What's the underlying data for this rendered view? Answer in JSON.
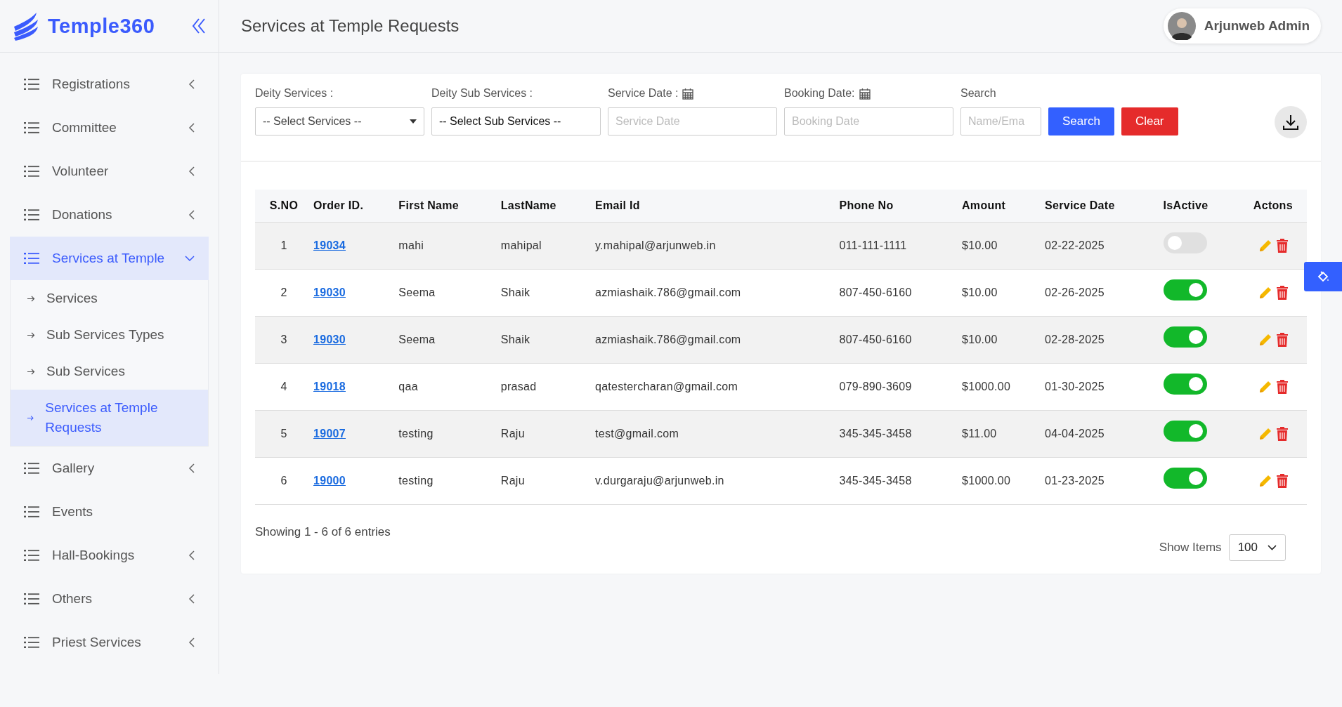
{
  "brand": {
    "name": "Temple360"
  },
  "sidebar": {
    "items": [
      {
        "label": "Registrations",
        "kind": "group",
        "expanded": false,
        "selected": false
      },
      {
        "label": "Committee",
        "kind": "group",
        "expanded": false,
        "selected": false
      },
      {
        "label": "Volunteer",
        "kind": "group",
        "expanded": false,
        "selected": false
      },
      {
        "label": "Donations",
        "kind": "group",
        "expanded": false,
        "selected": false
      },
      {
        "label": "Services at Temple",
        "kind": "group",
        "expanded": true,
        "selected": true,
        "children": [
          {
            "label": "Services",
            "selected": false
          },
          {
            "label": "Sub Services Types",
            "selected": false
          },
          {
            "label": "Sub Services",
            "selected": false
          },
          {
            "label": "Services at Temple Requests",
            "selected": true
          }
        ]
      },
      {
        "label": "Gallery",
        "kind": "group",
        "expanded": false,
        "selected": false
      },
      {
        "label": "Events",
        "kind": "link",
        "selected": false
      },
      {
        "label": "Hall-Bookings",
        "kind": "group",
        "expanded": false,
        "selected": false
      },
      {
        "label": "Others",
        "kind": "group",
        "expanded": false,
        "selected": false
      },
      {
        "label": "Priest Services",
        "kind": "group",
        "expanded": false,
        "selected": false
      }
    ]
  },
  "header": {
    "title": "Services at Temple Requests",
    "user": "Arjunweb Admin"
  },
  "filters": [
    {
      "label": "Deity Services :",
      "kind": "select",
      "value": "-- Select Services --"
    },
    {
      "label": "Deity Sub Services :",
      "kind": "plain_select",
      "value": "-- Select Sub Services --"
    },
    {
      "label": "Service Date :",
      "kind": "date",
      "placeholder": "Service Date"
    },
    {
      "label": "Booking Date:",
      "kind": "date",
      "placeholder": "Booking Date"
    },
    {
      "label": "Search",
      "kind": "text",
      "placeholder": "Name/Ema"
    }
  ],
  "buttons": [
    {
      "label": "Search",
      "kind": "primary"
    },
    {
      "label": "Clear",
      "kind": "danger"
    }
  ],
  "table": {
    "columns": [
      "S.NO",
      "Order ID.",
      "First Name",
      "LastName",
      "Email Id",
      "Phone No",
      "Amount",
      "Service Date",
      "IsActive",
      "Actons"
    ],
    "rows": [
      {
        "sno": "1",
        "order_id": "19034",
        "first_name": "mahi",
        "last_name": "mahipal",
        "email": "y.mahipal@arjunweb.in",
        "phone": "011-111-1111",
        "amount": "$10.00",
        "service_date": "02-22-2025",
        "active": false
      },
      {
        "sno": "2",
        "order_id": "19030",
        "first_name": "Seema",
        "last_name": "Shaik",
        "email": "azmiashaik.786@gmail.com",
        "phone": "807-450-6160",
        "amount": "$10.00",
        "service_date": "02-26-2025",
        "active": true
      },
      {
        "sno": "3",
        "order_id": "19030",
        "first_name": "Seema",
        "last_name": "Shaik",
        "email": "azmiashaik.786@gmail.com",
        "phone": "807-450-6160",
        "amount": "$10.00",
        "service_date": "02-28-2025",
        "active": true
      },
      {
        "sno": "4",
        "order_id": "19018",
        "first_name": "qaa",
        "last_name": "prasad",
        "email": "qatestercharan@gmail.com",
        "phone": "079-890-3609",
        "amount": "$1000.00",
        "service_date": "01-30-2025",
        "active": true
      },
      {
        "sno": "5",
        "order_id": "19007",
        "first_name": "testing",
        "last_name": "Raju",
        "email": "test@gmail.com",
        "phone": "345-345-3458",
        "amount": "$11.00",
        "service_date": "04-04-2025",
        "active": true
      },
      {
        "sno": "6",
        "order_id": "19000",
        "first_name": "testing",
        "last_name": "Raju",
        "email": "v.durgaraju@arjunweb.in",
        "phone": "345-345-3458",
        "amount": "$1000.00",
        "service_date": "01-23-2025",
        "active": true
      }
    ]
  },
  "footer": {
    "summary": "Showing 1 - 6 of 6 entries",
    "show_items_label": "Show Items",
    "show_items_value": "100"
  }
}
